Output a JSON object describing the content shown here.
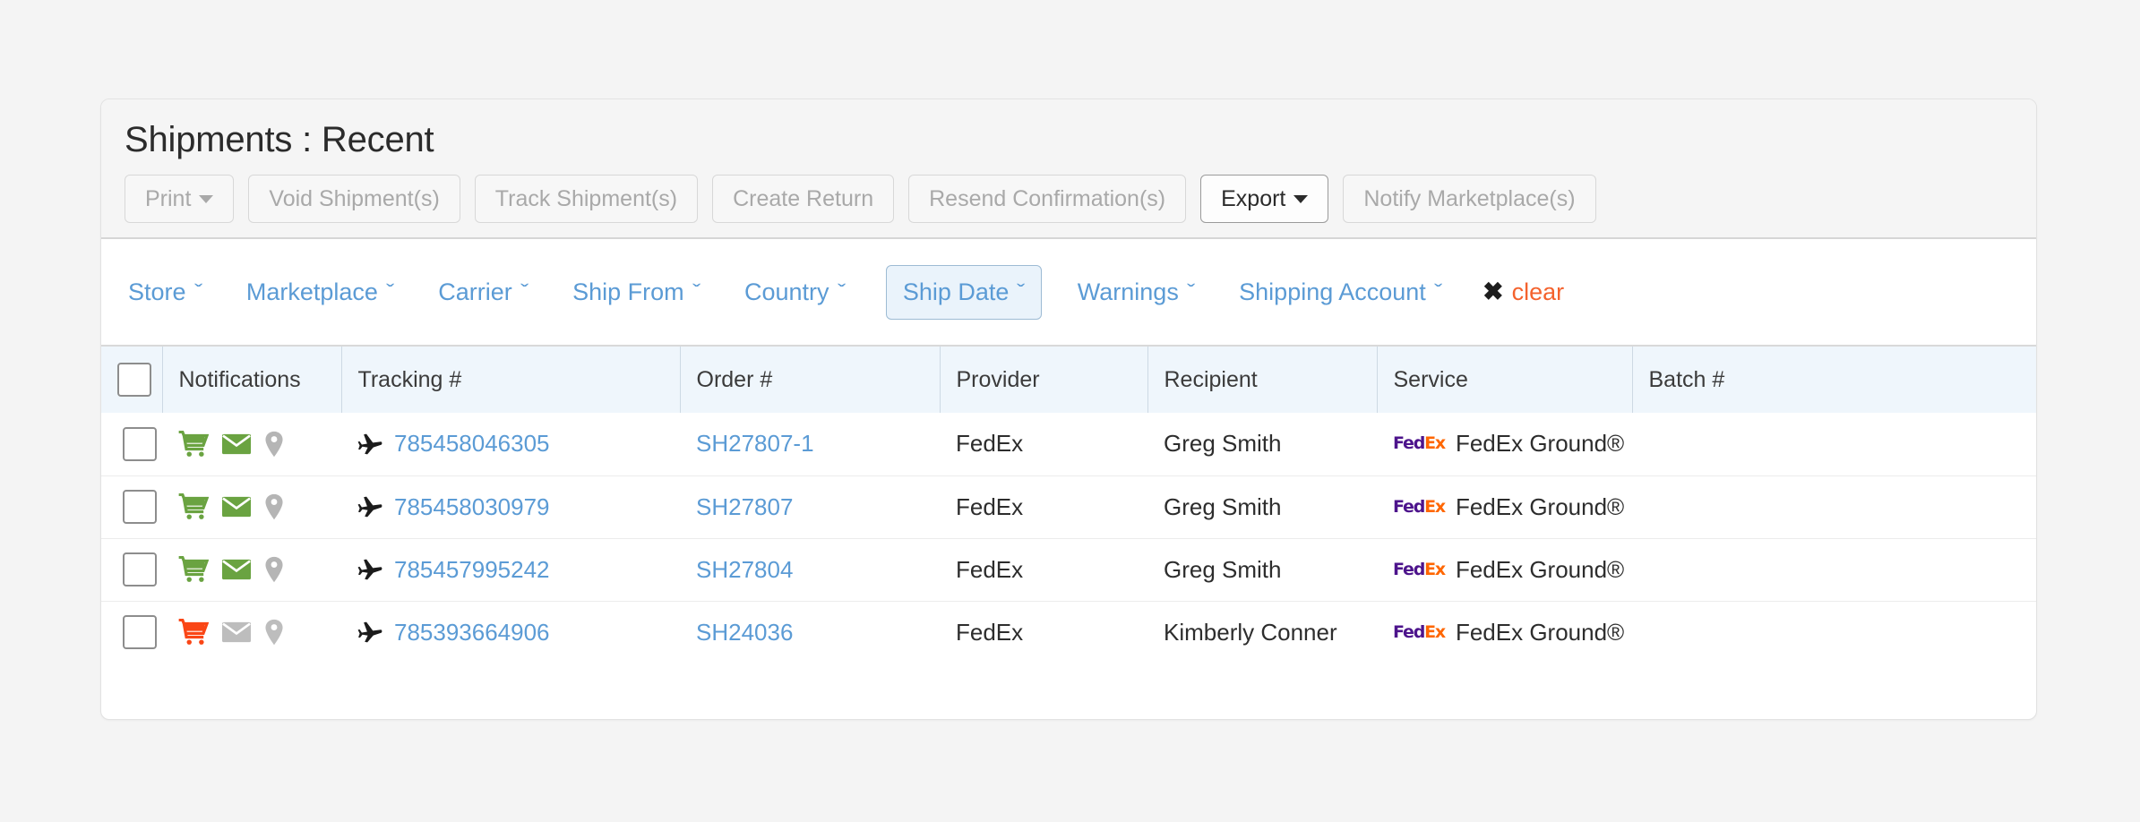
{
  "header": {
    "title": "Shipments : Recent"
  },
  "toolbar": {
    "buttons": [
      {
        "label": "Print",
        "caret": true,
        "enabled": false
      },
      {
        "label": "Void Shipment(s)",
        "caret": false,
        "enabled": false
      },
      {
        "label": "Track Shipment(s)",
        "caret": false,
        "enabled": false
      },
      {
        "label": "Create Return",
        "caret": false,
        "enabled": false
      },
      {
        "label": "Resend Confirmation(s)",
        "caret": false,
        "enabled": false
      },
      {
        "label": "Export",
        "caret": true,
        "enabled": true
      },
      {
        "label": "Notify Marketplace(s)",
        "caret": false,
        "enabled": false
      }
    ]
  },
  "filters": {
    "items": [
      {
        "label": "Store",
        "active": false
      },
      {
        "label": "Marketplace",
        "active": false
      },
      {
        "label": "Carrier",
        "active": false
      },
      {
        "label": "Ship From",
        "active": false
      },
      {
        "label": "Country",
        "active": false
      },
      {
        "label": "Ship Date",
        "active": true
      },
      {
        "label": "Warnings",
        "active": false
      },
      {
        "label": "Shipping Account",
        "active": false
      }
    ],
    "chevron": "ˇ",
    "clear_label": "clear",
    "clear_icon": "✖"
  },
  "table": {
    "columns": [
      {
        "key": "check",
        "label": ""
      },
      {
        "key": "notif",
        "label": "Notifications"
      },
      {
        "key": "track",
        "label": "Tracking #"
      },
      {
        "key": "order",
        "label": "Order #"
      },
      {
        "key": "prov",
        "label": "Provider"
      },
      {
        "key": "recip",
        "label": "Recipient"
      },
      {
        "key": "serv",
        "label": "Service"
      },
      {
        "key": "batch",
        "label": "Batch #"
      }
    ],
    "rows": [
      {
        "selected": false,
        "cart_color": "#6aa341",
        "mail_color": "#6aa341",
        "pin_color": "#b5b5b5",
        "tracking": "785458046305",
        "order": "SH27807-1",
        "provider": "FedEx",
        "recipient": "Greg Smith",
        "service": "FedEx Ground®",
        "batch": ""
      },
      {
        "selected": false,
        "cart_color": "#6aa341",
        "mail_color": "#6aa341",
        "pin_color": "#b5b5b5",
        "tracking": "785458030979",
        "order": "SH27807",
        "provider": "FedEx",
        "recipient": "Greg Smith",
        "service": "FedEx Ground®",
        "batch": ""
      },
      {
        "selected": false,
        "cart_color": "#6aa341",
        "mail_color": "#6aa341",
        "pin_color": "#b5b5b5",
        "tracking": "785457995242",
        "order": "SH27804",
        "provider": "FedEx",
        "recipient": "Greg Smith",
        "service": "FedEx Ground®",
        "batch": ""
      },
      {
        "selected": false,
        "cart_color": "#fa4616",
        "mail_color": "#bdbdbd",
        "pin_color": "#bdbdbd",
        "tracking": "785393664906",
        "order": "SH24036",
        "provider": "FedEx",
        "recipient": "Kimberly Conner",
        "service": "FedEx Ground®",
        "batch": ""
      }
    ]
  },
  "logos": {
    "fedex_fed": "Fed",
    "fedex_ex": "Ex"
  },
  "colors": {
    "link": "#5b9bd5",
    "accent_clear": "#f4622d",
    "header_bg": "#eff6fc",
    "toolbar_bg": "#f5f5f5",
    "page_bg": "#f4f4f4",
    "fedex_purple": "#4d148c",
    "fedex_orange": "#ff6600"
  }
}
